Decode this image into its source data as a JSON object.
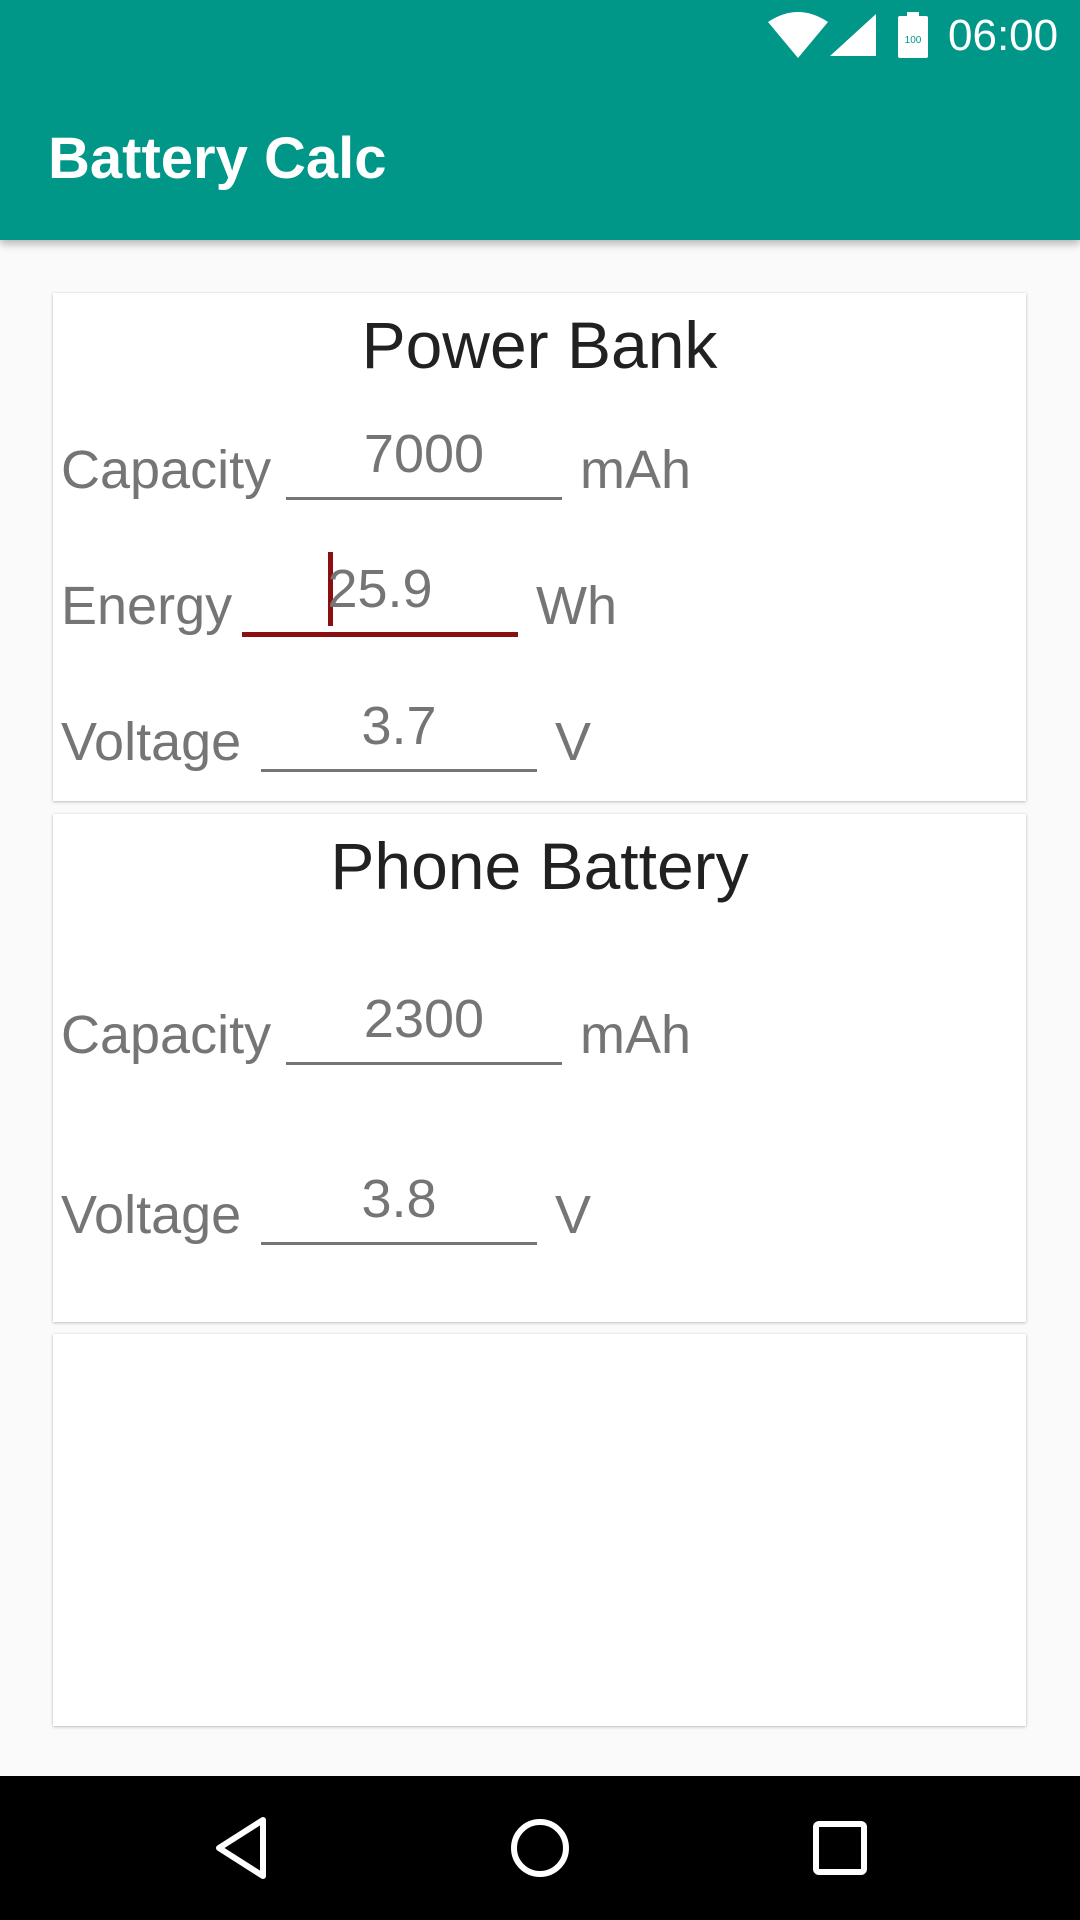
{
  "status_bar": {
    "time": "06:00",
    "battery_level": "100",
    "icons": [
      "wifi-icon",
      "cell-signal-icon",
      "battery-icon"
    ]
  },
  "app_bar": {
    "title": "Battery Calc",
    "color": "#009688"
  },
  "power_bank": {
    "title": "Power Bank",
    "capacity": {
      "label": "Capacity",
      "value": "7000",
      "unit": "mAh"
    },
    "energy": {
      "label": "Energy",
      "value": "25.9",
      "unit": "Wh"
    },
    "voltage": {
      "label": "Voltage",
      "value": "3.7",
      "unit": "V"
    }
  },
  "phone_battery": {
    "title": "Phone Battery",
    "capacity": {
      "label": "Capacity",
      "value": "2300",
      "unit": "mAh"
    },
    "voltage": {
      "label": "Voltage",
      "value": "3.8",
      "unit": "V"
    }
  },
  "colors": {
    "accent": "#8b0e10",
    "text_secondary": "#757575",
    "text_primary": "#212121"
  },
  "nav_bar": {
    "icons": [
      "back-triangle-icon",
      "home-circle-icon",
      "recents-square-icon"
    ]
  }
}
